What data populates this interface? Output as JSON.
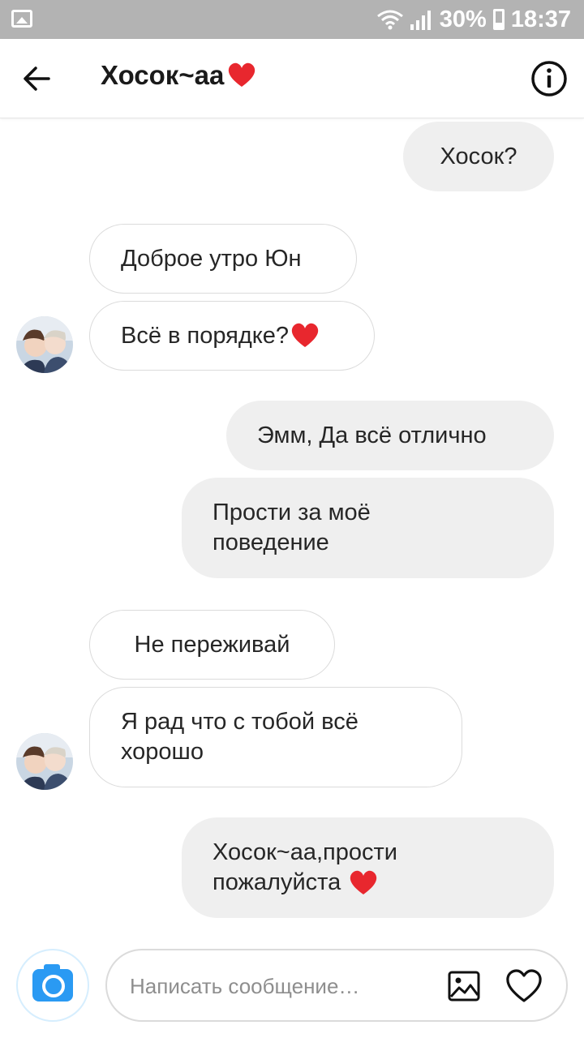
{
  "status_bar": {
    "battery": "30%",
    "time": "18:37"
  },
  "header": {
    "title": "Хосок~аа",
    "title_emoji": "heart"
  },
  "avatar_description": "user-avatar",
  "messages": [
    {
      "dir": "out",
      "text": "Хосок?"
    },
    {
      "dir": "in",
      "text": "Доброе утро Юн"
    },
    {
      "dir": "in",
      "text": "Всё в порядке?",
      "emoji": "heart",
      "avatar": true
    },
    {
      "dir": "out",
      "text": "Эмм, Да всё отлично"
    },
    {
      "dir": "out",
      "lines": [
        "Прости за моё",
        "поведение"
      ]
    },
    {
      "dir": "in",
      "text": "Не переживай"
    },
    {
      "dir": "in",
      "lines": [
        "Я рад что с тобой всё",
        "хорошо"
      ],
      "avatar": true
    },
    {
      "dir": "out",
      "lines": [
        "Хосок~аа,прости",
        "пожалуйста "
      ],
      "emoji": "heart"
    }
  ],
  "composer": {
    "placeholder": "Написать сообщение…"
  },
  "colors": {
    "status_bar": "#b3b3b3",
    "bubble_out": "#efefef",
    "bubble_in_border": "#dbdbdb",
    "camera_blue": "#2a9af3",
    "heart_red": "#e8272e"
  }
}
